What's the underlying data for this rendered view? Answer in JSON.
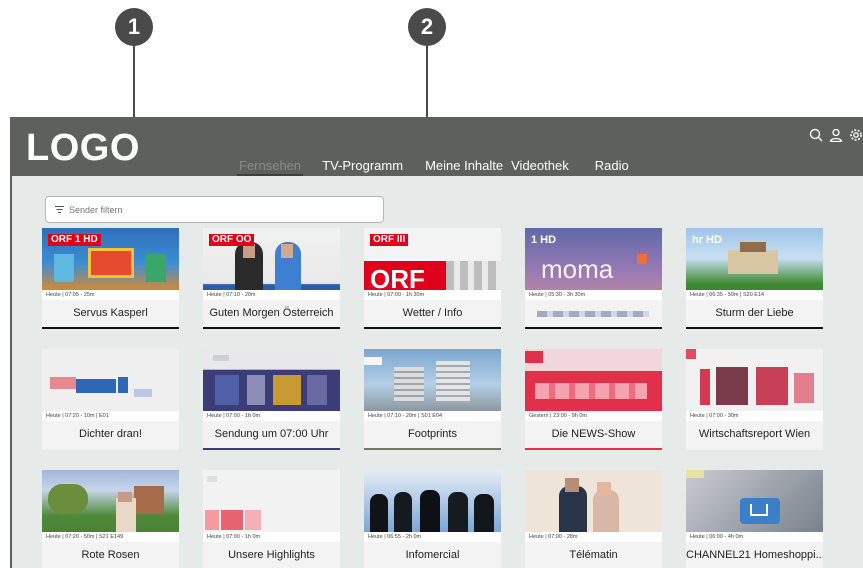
{
  "callouts": [
    "1",
    "2"
  ],
  "app": {
    "logo": "LOGO"
  },
  "nav": [
    "Fernsehen",
    "TV-Programm",
    "Meine Inhalte",
    "Videothek",
    "Radio"
  ],
  "filter": {
    "placeholder": "Sender filtern"
  },
  "channels": [
    {
      "logo": "ORF 1 HD",
      "meta": "Heute | 07:05 - 25m",
      "title": "Servus Kasperl"
    },
    {
      "logo": "ORF OÖ",
      "meta": "Heute | 07:10 - 20m",
      "title": "Guten Morgen Österreich"
    },
    {
      "logo": "ORF III",
      "meta": "Heute | 07:00 - 1h 30m",
      "title": "Wetter / Info"
    },
    {
      "logo": "1 HD",
      "meta": "Heute | 05:30 - 3h 30m",
      "title": "",
      "thumb_text": "moma"
    },
    {
      "logo": "hr HD",
      "meta": "Heute | 06:35 - 50m | S20 E14",
      "title": "Sturm der Liebe"
    },
    {
      "logo": "",
      "meta": "Heute | 07:20 - 10m | E01",
      "title": "Dichter dran!"
    },
    {
      "logo": "",
      "meta": "Heute | 07:00 - 1h 0m",
      "title": "Sendung um 07:00 Uhr"
    },
    {
      "logo": "",
      "meta": "Heute | 07:10 - 20m | S01 E04",
      "title": "Footprints"
    },
    {
      "logo": "",
      "meta": "Gestern | 23:00 - 9h 0m",
      "title": "Die NEWS-Show"
    },
    {
      "logo": "",
      "meta": "Heute | 07:00 - 30m",
      "title": "Wirtschaftsreport Wien"
    },
    {
      "logo": "",
      "meta": "Heute | 07:20 - 50m | S21 E149",
      "title": "Rote Rosen"
    },
    {
      "logo": "",
      "meta": "Heute | 07:00 - 1h 0m",
      "title": "Unsere Highlights"
    },
    {
      "logo": "",
      "meta": "Heute | 06:55 - 2h 0m",
      "title": "Infomercial"
    },
    {
      "logo": "",
      "meta": "Heute | 07:00 - 28m",
      "title": "Télématin"
    },
    {
      "logo": "",
      "meta": "Heute | 06:00 - 4h 0m",
      "title": "CHANNEL21 Homeshoppi..."
    }
  ],
  "colors": {
    "header": "#5e605d",
    "background": "#e6ebea",
    "orf_red": "#e0001b"
  }
}
